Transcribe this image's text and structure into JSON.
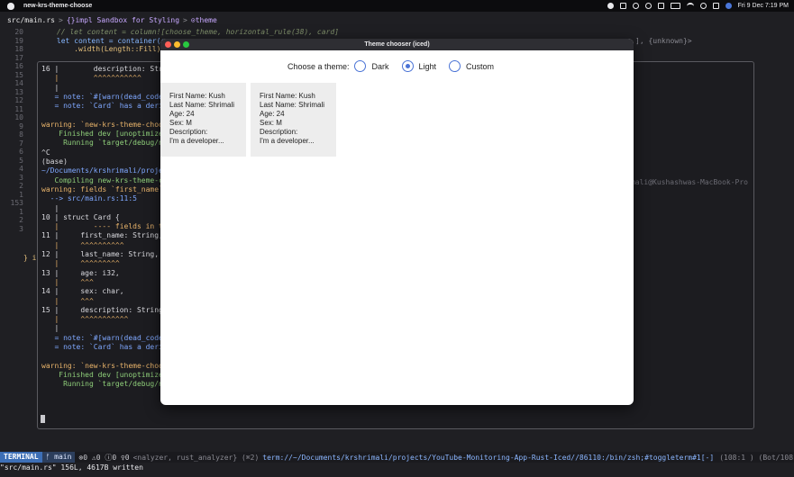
{
  "menubar": {
    "app_name": "new-krs-theme-choose",
    "datetime": "Fri 9 Dec 7:19 PM"
  },
  "breadcrumb": {
    "file": "src/main.rs",
    "sep1": ">",
    "impl": "{}impl Sandbox for Styling",
    "sep2": ">",
    "symbol": "⊙theme"
  },
  "editor": {
    "gutter": [
      "20",
      "19",
      "18",
      "17",
      "16",
      "15",
      "14",
      "13",
      "12",
      "11",
      "10",
      "9",
      "8",
      "7",
      "6",
      "5",
      "4",
      "3",
      "2",
      "1",
      "153",
      "1",
      "2",
      "3"
    ],
    "line20": "      // let content = column![choose_theme, horizontal_rule(38), card]",
    "line19a": "      let content = container(c",
    "line19b": "], {unknown}>",
    "line18": "          .width(Length::Fill)",
    "line3": "} i"
  },
  "terminal": {
    "lines": [
      "16 |        description: String,",
      "   |        ^^^^^^^^^^^",
      "   |",
      "   = note: `#[warn(dead_code)",
      "   = note: `Card` has a deriv",
      "",
      "warning: `new-krs-theme-choos",
      "    Finished dev [unoptimized",
      "     Running `target/debug/ne",
      "^C",
      "(base)",
      "~/Documents/krshrimali/project",
      "   Compiling new-krs-theme-ch",
      "warning: fields `first_name`,",
      "  --> src/main.rs:11:5",
      "   |",
      "10 | struct Card {",
      "   |        ---- fields in th",
      "11 |     first_name: String,",
      "   |     ^^^^^^^^^^",
      "12 |     last_name: String,",
      "   |     ^^^^^^^^^",
      "13 |     age: i32,",
      "   |     ^^^",
      "14 |     sex: char,",
      "   |     ^^^",
      "15 |     description: String,",
      "   |     ^^^^^^^^^^^",
      "   |",
      "   = note: `#[warn(dead_code)",
      "   = note: `Card` has a deriv",
      "",
      "warning: `new-krs-theme-choos",
      "    Finished dev [unoptimized",
      "     Running `target/debug/new-krs-theme-choose"
    ],
    "host_right": "mali@Kushashwas-MacBook-Pro"
  },
  "statusbar": {
    "mode": "TERMINAL",
    "branch": "ᚠ main",
    "diagnostics": "⊗0 ⚠0 ⓘ0 ♀0",
    "lsp": "<nalyzer, rust_analyzer} (⌘2)",
    "path": "term://~/Documents/krshrimali/projects/YouTube-Monitoring-App-Rust-Iced//86110:/bin/zsh;#toggleterm#1[-]",
    "position": "(108:1 ) (Bot/108)"
  },
  "cmdline": "\"src/main.rs\" 156L, 4617B written",
  "window": {
    "title": "Theme chooser (iced)",
    "choose_label": "Choose a theme:",
    "options": [
      "Dark",
      "Light",
      "Custom"
    ],
    "selected": "Light",
    "cards": [
      {
        "first": "First Name: Kush",
        "last": "Last Name: Shrimali",
        "age": "Age: 24",
        "sex": "Sex: M",
        "desc_label": "Description:",
        "desc": "I'm a developer..."
      },
      {
        "first": "First Name: Kush",
        "last": "Last Name: Shrimali",
        "age": "Age: 24",
        "sex": "Sex: M",
        "desc_label": "Description:",
        "desc": "I'm a developer..."
      }
    ]
  },
  "colors": {
    "accent_blue": "#4a73d6",
    "terminal_mode": "#3d6fb6"
  }
}
